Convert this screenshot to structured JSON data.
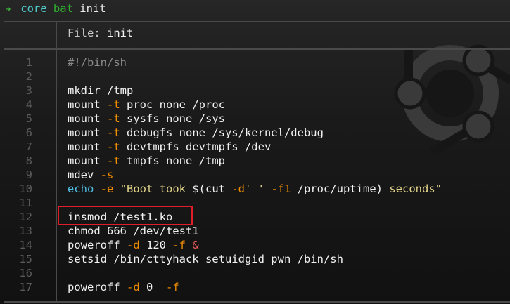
{
  "prompt": {
    "dir": "core",
    "cmd": "bat",
    "arg": "init"
  },
  "header": {
    "label": "File: ",
    "filename": "init"
  },
  "lines": [
    [
      {
        "t": "#!/bin/sh",
        "c": "cmt"
      }
    ],
    [],
    [
      {
        "t": "mkdir /tmp"
      }
    ],
    [
      {
        "t": "mount "
      },
      {
        "t": "-t",
        "c": "flag"
      },
      {
        "t": " proc none /proc"
      }
    ],
    [
      {
        "t": "mount "
      },
      {
        "t": "-t",
        "c": "flag"
      },
      {
        "t": " sysfs none /sys"
      }
    ],
    [
      {
        "t": "mount "
      },
      {
        "t": "-t",
        "c": "flag"
      },
      {
        "t": " debugfs none /sys/kernel/debug"
      }
    ],
    [
      {
        "t": "mount "
      },
      {
        "t": "-t",
        "c": "flag"
      },
      {
        "t": " devtmpfs devtmpfs /dev"
      }
    ],
    [
      {
        "t": "mount "
      },
      {
        "t": "-t",
        "c": "flag"
      },
      {
        "t": " tmpfs none /tmp"
      }
    ],
    [
      {
        "t": "mdev "
      },
      {
        "t": "-s",
        "c": "flag"
      }
    ],
    [
      {
        "t": "echo",
        "c": "kw"
      },
      {
        "t": " "
      },
      {
        "t": "-e",
        "c": "flag"
      },
      {
        "t": " "
      },
      {
        "t": "\"Boot took ",
        "c": "str"
      },
      {
        "t": "$(cut "
      },
      {
        "t": "-d",
        "c": "flag"
      },
      {
        "t": "' '",
        "c": "str"
      },
      {
        "t": " "
      },
      {
        "t": "-f1",
        "c": "flag"
      },
      {
        "t": " /proc/uptime)"
      },
      {
        "t": " seconds\"",
        "c": "str"
      }
    ],
    [],
    [
      {
        "t": "insmod /test1.ko"
      }
    ],
    [
      {
        "t": "chmod 666 /dev/test1"
      }
    ],
    [
      {
        "t": "poweroff "
      },
      {
        "t": "-d",
        "c": "flag"
      },
      {
        "t": " 120 "
      },
      {
        "t": "-f",
        "c": "flag"
      },
      {
        "t": " "
      },
      {
        "t": "&",
        "c": "amp"
      }
    ],
    [
      {
        "t": "setsid /bin/cttyhack setuidgid pwn /bin/sh"
      }
    ],
    [],
    [
      {
        "t": "poweroff "
      },
      {
        "t": "-d",
        "c": "flag"
      },
      {
        "t": " 0  "
      },
      {
        "t": "-f",
        "c": "flag"
      }
    ]
  ],
  "line_numbers": [
    "1",
    "2",
    "3",
    "4",
    "5",
    "6",
    "7",
    "8",
    "9",
    "10",
    "11",
    "12",
    "13",
    "14",
    "15",
    "16",
    "17"
  ]
}
